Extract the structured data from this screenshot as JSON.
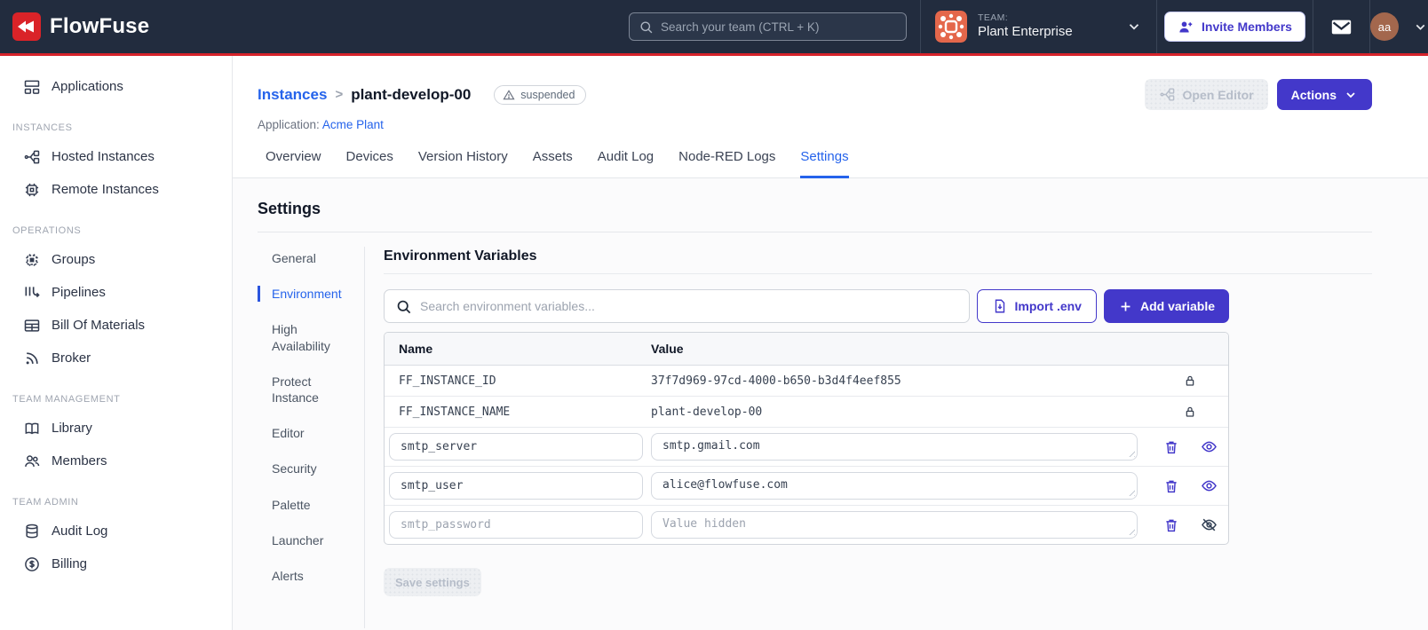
{
  "colors": {
    "brand_red": "#da2328",
    "primary_indigo": "#4338ca",
    "link_blue": "#2563eb",
    "navbar_bg": "#222c3e",
    "team_avatar_orange": "#e4674b",
    "user_avatar_brown": "#a3674d"
  },
  "navbar": {
    "brand": "FlowFuse",
    "search_placeholder": "Search your team (CTRL + K)",
    "team": {
      "label": "TEAM:",
      "name": "Plant Enterprise"
    },
    "invite_button": "Invite Members",
    "avatar_initials": "aa"
  },
  "sidebar": {
    "sections": [
      {
        "label": "",
        "items": [
          {
            "label": "Applications"
          }
        ]
      },
      {
        "label": "INSTANCES",
        "items": [
          {
            "label": "Hosted Instances"
          },
          {
            "label": "Remote Instances"
          }
        ]
      },
      {
        "label": "OPERATIONS",
        "items": [
          {
            "label": "Groups"
          },
          {
            "label": "Pipelines"
          },
          {
            "label": "Bill Of Materials"
          },
          {
            "label": "Broker"
          }
        ]
      },
      {
        "label": "TEAM MANAGEMENT",
        "items": [
          {
            "label": "Library"
          },
          {
            "label": "Members"
          }
        ]
      },
      {
        "label": "TEAM ADMIN",
        "items": [
          {
            "label": "Audit Log"
          },
          {
            "label": "Billing"
          }
        ]
      }
    ]
  },
  "header": {
    "breadcrumb": {
      "parent": "Instances",
      "separator": ">",
      "current": "plant-develop-00"
    },
    "status_badge": "suspended",
    "application_label": "Application:",
    "application_name": "Acme Plant",
    "open_editor_button": "Open Editor",
    "actions_button": "Actions"
  },
  "tabs": {
    "items": [
      "Overview",
      "Devices",
      "Version History",
      "Assets",
      "Audit Log",
      "Node-RED Logs",
      "Settings"
    ],
    "active": "Settings"
  },
  "settings": {
    "title": "Settings",
    "subnav": {
      "items": [
        "General",
        "Environment",
        "High Availability",
        "Protect Instance",
        "Editor",
        "Security",
        "Palette",
        "Launcher",
        "Alerts"
      ],
      "active": "Environment"
    },
    "panel": {
      "title": "Environment Variables",
      "search_placeholder": "Search environment variables...",
      "import_button": "Import .env",
      "add_button": "Add variable",
      "table": {
        "columns": {
          "name": "Name",
          "value": "Value"
        },
        "locked_rows": [
          {
            "name": "FF_INSTANCE_ID",
            "value": "37f7d969-97cd-4000-b650-b3d4f4eef855"
          },
          {
            "name": "FF_INSTANCE_NAME",
            "value": "plant-develop-00"
          }
        ],
        "editable_rows": [
          {
            "name": "smtp_server",
            "value": "smtp.gmail.com"
          },
          {
            "name": "smtp_user",
            "value": "alice@flowfuse.com"
          },
          {
            "name": "smtp_password",
            "value": "",
            "value_placeholder": "Value hidden"
          }
        ]
      },
      "save_button": "Save settings"
    }
  }
}
